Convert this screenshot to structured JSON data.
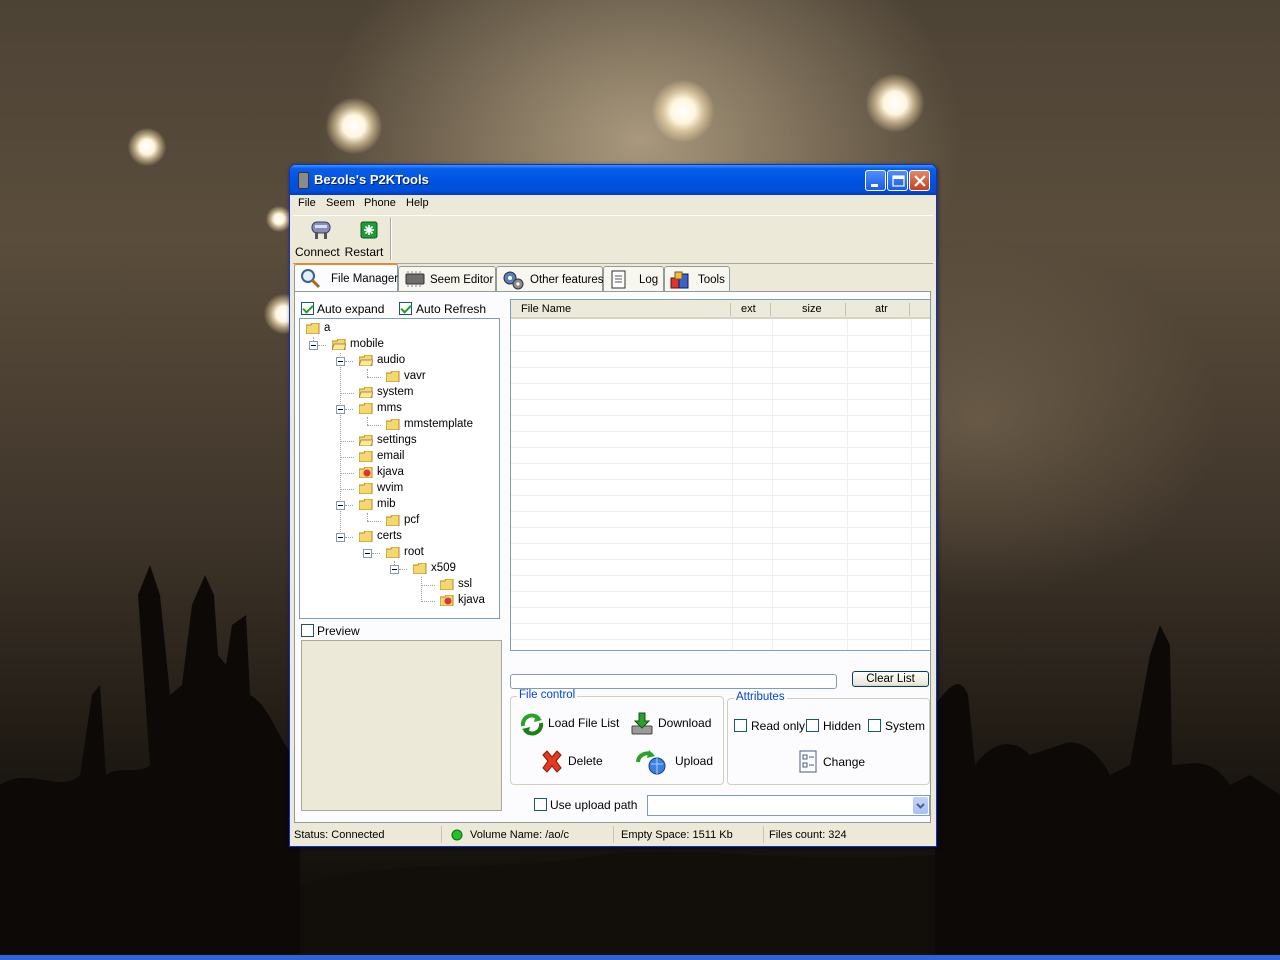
{
  "window": {
    "title": "Bezols's P2KTools"
  },
  "menu": [
    "File",
    "Seem",
    "Phone",
    "Help"
  ],
  "toolbar": {
    "connect_label": "Connect",
    "restart_label": "Restart"
  },
  "tabs": [
    {
      "label": "File Manager",
      "icon": "magnifier-icon",
      "active": true
    },
    {
      "label": "Seem Editor",
      "icon": "chip-icon",
      "active": false
    },
    {
      "label": "Other features",
      "icon": "gears-icon",
      "active": false
    },
    {
      "label": "Log",
      "icon": "notepad-icon",
      "active": false
    },
    {
      "label": "Tools",
      "icon": "toolbox-icon",
      "active": false
    }
  ],
  "file_manager": {
    "auto_expand": {
      "label": "Auto expand",
      "checked": true
    },
    "auto_refresh": {
      "label": "Auto Refresh",
      "checked": true
    },
    "preview": {
      "label": "Preview",
      "checked": false
    },
    "tree": [
      {
        "name": "a"
      },
      {
        "name": "mobile"
      },
      {
        "name": "audio"
      },
      {
        "name": "vavr"
      },
      {
        "name": "system"
      },
      {
        "name": "mms"
      },
      {
        "name": "mmstemplate"
      },
      {
        "name": "settings"
      },
      {
        "name": "email"
      },
      {
        "name": "kjava"
      },
      {
        "name": "wvim"
      },
      {
        "name": "mib"
      },
      {
        "name": "pcf"
      },
      {
        "name": "certs"
      },
      {
        "name": "root"
      },
      {
        "name": "x509"
      },
      {
        "name": "ssl"
      },
      {
        "name": "kjava"
      }
    ],
    "file_list": {
      "columns": [
        "File Name",
        "ext",
        "size",
        "atr"
      ],
      "rows": []
    },
    "clear_list_label": "Clear List",
    "file_control": {
      "title": "File control",
      "load_file_list": "Load File List",
      "download": "Download",
      "delete": "Delete",
      "upload": "Upload"
    },
    "attributes": {
      "title": "Attributes",
      "read_only": {
        "label": "Read only",
        "checked": false
      },
      "hidden": {
        "label": "Hidden",
        "checked": false
      },
      "system": {
        "label": "System",
        "checked": false
      },
      "change": "Change"
    },
    "use_upload_path": {
      "label": "Use upload path",
      "checked": false,
      "value": ""
    }
  },
  "status": {
    "status": "Status: Connected",
    "volume": "Volume Name: /aо/c",
    "empty_space": "Empty Space: 1511 Kb",
    "files_count": "Files count: 324"
  }
}
